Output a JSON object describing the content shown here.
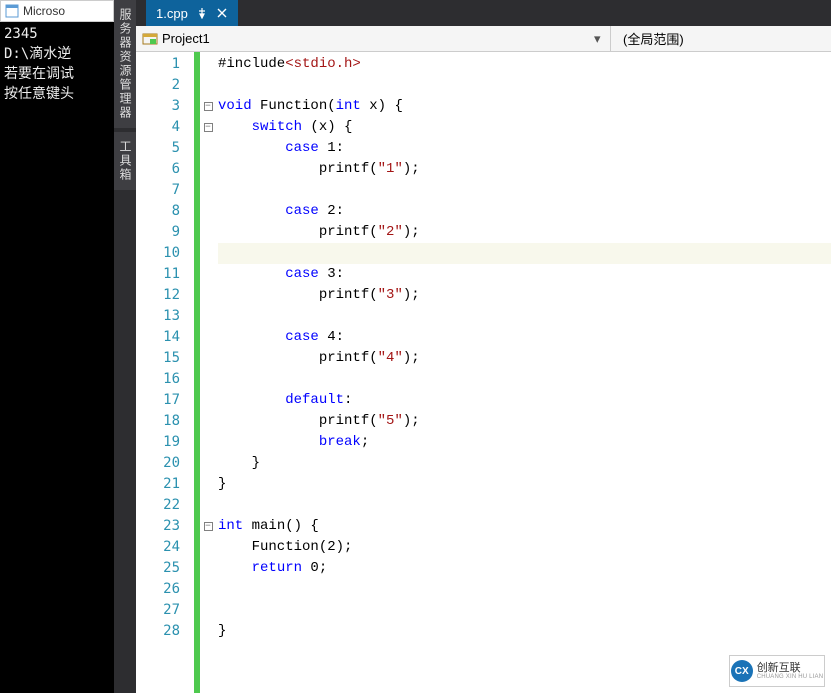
{
  "console": {
    "title": "Microso",
    "lines": [
      "2345",
      "D:\\滴水逆",
      "若要在调试",
      "按任意键头"
    ]
  },
  "side_tabs": [
    "服务器资源管理器",
    "工具箱"
  ],
  "doc_tab": {
    "label": "1.cpp"
  },
  "nav": {
    "project": "Project1",
    "scope": "(全局范围)"
  },
  "code": {
    "lines": [
      {
        "n": 1,
        "fold": "",
        "seg": [
          {
            "c": "txt",
            "t": "#include"
          },
          {
            "c": "red",
            "t": "<stdio.h>"
          }
        ]
      },
      {
        "n": 2,
        "fold": "",
        "seg": []
      },
      {
        "n": 3,
        "fold": "box",
        "seg": [
          {
            "c": "kw",
            "t": "void"
          },
          {
            "c": "txt",
            "t": " Function("
          },
          {
            "c": "kw",
            "t": "int"
          },
          {
            "c": "txt",
            "t": " x) {"
          }
        ]
      },
      {
        "n": 4,
        "fold": "box",
        "seg": [
          {
            "c": "txt",
            "t": "    "
          },
          {
            "c": "kw",
            "t": "switch"
          },
          {
            "c": "txt",
            "t": " (x) {"
          }
        ]
      },
      {
        "n": 5,
        "fold": "",
        "seg": [
          {
            "c": "txt",
            "t": "        "
          },
          {
            "c": "kw",
            "t": "case"
          },
          {
            "c": "txt",
            "t": " 1:"
          }
        ]
      },
      {
        "n": 6,
        "fold": "",
        "seg": [
          {
            "c": "txt",
            "t": "            printf("
          },
          {
            "c": "red",
            "t": "\"1\""
          },
          {
            "c": "txt",
            "t": ");"
          }
        ]
      },
      {
        "n": 7,
        "fold": "",
        "seg": []
      },
      {
        "n": 8,
        "fold": "",
        "seg": [
          {
            "c": "txt",
            "t": "        "
          },
          {
            "c": "kw",
            "t": "case"
          },
          {
            "c": "txt",
            "t": " 2:"
          }
        ]
      },
      {
        "n": 9,
        "fold": "",
        "seg": [
          {
            "c": "txt",
            "t": "            printf("
          },
          {
            "c": "red",
            "t": "\"2\""
          },
          {
            "c": "txt",
            "t": ");"
          }
        ]
      },
      {
        "n": 10,
        "fold": "",
        "cursor": true,
        "seg": []
      },
      {
        "n": 11,
        "fold": "",
        "seg": [
          {
            "c": "txt",
            "t": "        "
          },
          {
            "c": "kw",
            "t": "case"
          },
          {
            "c": "txt",
            "t": " 3:"
          }
        ]
      },
      {
        "n": 12,
        "fold": "",
        "seg": [
          {
            "c": "txt",
            "t": "            printf("
          },
          {
            "c": "red",
            "t": "\"3\""
          },
          {
            "c": "txt",
            "t": ");"
          }
        ]
      },
      {
        "n": 13,
        "fold": "",
        "seg": []
      },
      {
        "n": 14,
        "fold": "",
        "seg": [
          {
            "c": "txt",
            "t": "        "
          },
          {
            "c": "kw",
            "t": "case"
          },
          {
            "c": "txt",
            "t": " 4:"
          }
        ]
      },
      {
        "n": 15,
        "fold": "",
        "seg": [
          {
            "c": "txt",
            "t": "            printf("
          },
          {
            "c": "red",
            "t": "\"4\""
          },
          {
            "c": "txt",
            "t": ");"
          }
        ]
      },
      {
        "n": 16,
        "fold": "",
        "seg": []
      },
      {
        "n": 17,
        "fold": "",
        "seg": [
          {
            "c": "txt",
            "t": "        "
          },
          {
            "c": "kw",
            "t": "default"
          },
          {
            "c": "txt",
            "t": ":"
          }
        ]
      },
      {
        "n": 18,
        "fold": "",
        "seg": [
          {
            "c": "txt",
            "t": "            printf("
          },
          {
            "c": "red",
            "t": "\"5\""
          },
          {
            "c": "txt",
            "t": ");"
          }
        ]
      },
      {
        "n": 19,
        "fold": "",
        "seg": [
          {
            "c": "txt",
            "t": "            "
          },
          {
            "c": "kw",
            "t": "break"
          },
          {
            "c": "txt",
            "t": ";"
          }
        ]
      },
      {
        "n": 20,
        "fold": "",
        "seg": [
          {
            "c": "txt",
            "t": "    }"
          }
        ]
      },
      {
        "n": 21,
        "fold": "",
        "seg": [
          {
            "c": "txt",
            "t": "}"
          }
        ]
      },
      {
        "n": 22,
        "fold": "",
        "seg": []
      },
      {
        "n": 23,
        "fold": "box",
        "seg": [
          {
            "c": "kw",
            "t": "int"
          },
          {
            "c": "txt",
            "t": " main() {"
          }
        ]
      },
      {
        "n": 24,
        "fold": "",
        "seg": [
          {
            "c": "txt",
            "t": "    Function(2);"
          }
        ]
      },
      {
        "n": 25,
        "fold": "",
        "seg": [
          {
            "c": "txt",
            "t": "    "
          },
          {
            "c": "kw",
            "t": "return"
          },
          {
            "c": "txt",
            "t": " 0;"
          }
        ]
      },
      {
        "n": 26,
        "fold": "",
        "seg": []
      },
      {
        "n": 27,
        "fold": "",
        "seg": []
      },
      {
        "n": 28,
        "fold": "",
        "seg": [
          {
            "c": "txt",
            "t": "}"
          }
        ]
      }
    ]
  },
  "logo": {
    "mark": "CX",
    "cn": "创新互联",
    "en": "CHUANG XIN HU LIAN"
  }
}
